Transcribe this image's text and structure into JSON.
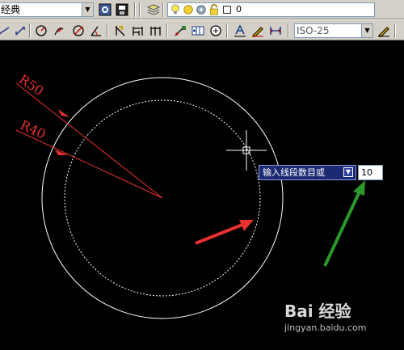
{
  "toolbar": {
    "workspace_value": "经典",
    "layer_value": "0",
    "dimstyle_value": "ISO-25"
  },
  "drawing": {
    "labels": {
      "outer_radius": "R50",
      "inner_radius": "R40"
    },
    "colors": {
      "background": "#000000",
      "geometry": "#ffffff",
      "annotation": "#e8312f",
      "callout_green": "#2a9a2a"
    }
  },
  "command": {
    "prompt": "输入线段数目或",
    "input_value": "10"
  },
  "watermark": {
    "brand": "Bai 经验",
    "url": "jingyan.baidu.com"
  },
  "icons": [
    "workspace-settings-icon",
    "layers-icon",
    "lightbulb-icon",
    "sun-icon",
    "gear-icon",
    "lock-icon",
    "color-swatch-icon",
    "dim-linear-icon",
    "dim-aligned-icon",
    "dim-radius-icon",
    "dim-diameter-icon",
    "dim-angular-icon",
    "quick-dim-icon",
    "baseline-icon",
    "continue-icon",
    "leader-icon",
    "tolerance-icon",
    "center-mark-icon",
    "dim-edit-icon",
    "dim-text-edit-icon",
    "dim-update-icon",
    "dim-style-icon"
  ]
}
